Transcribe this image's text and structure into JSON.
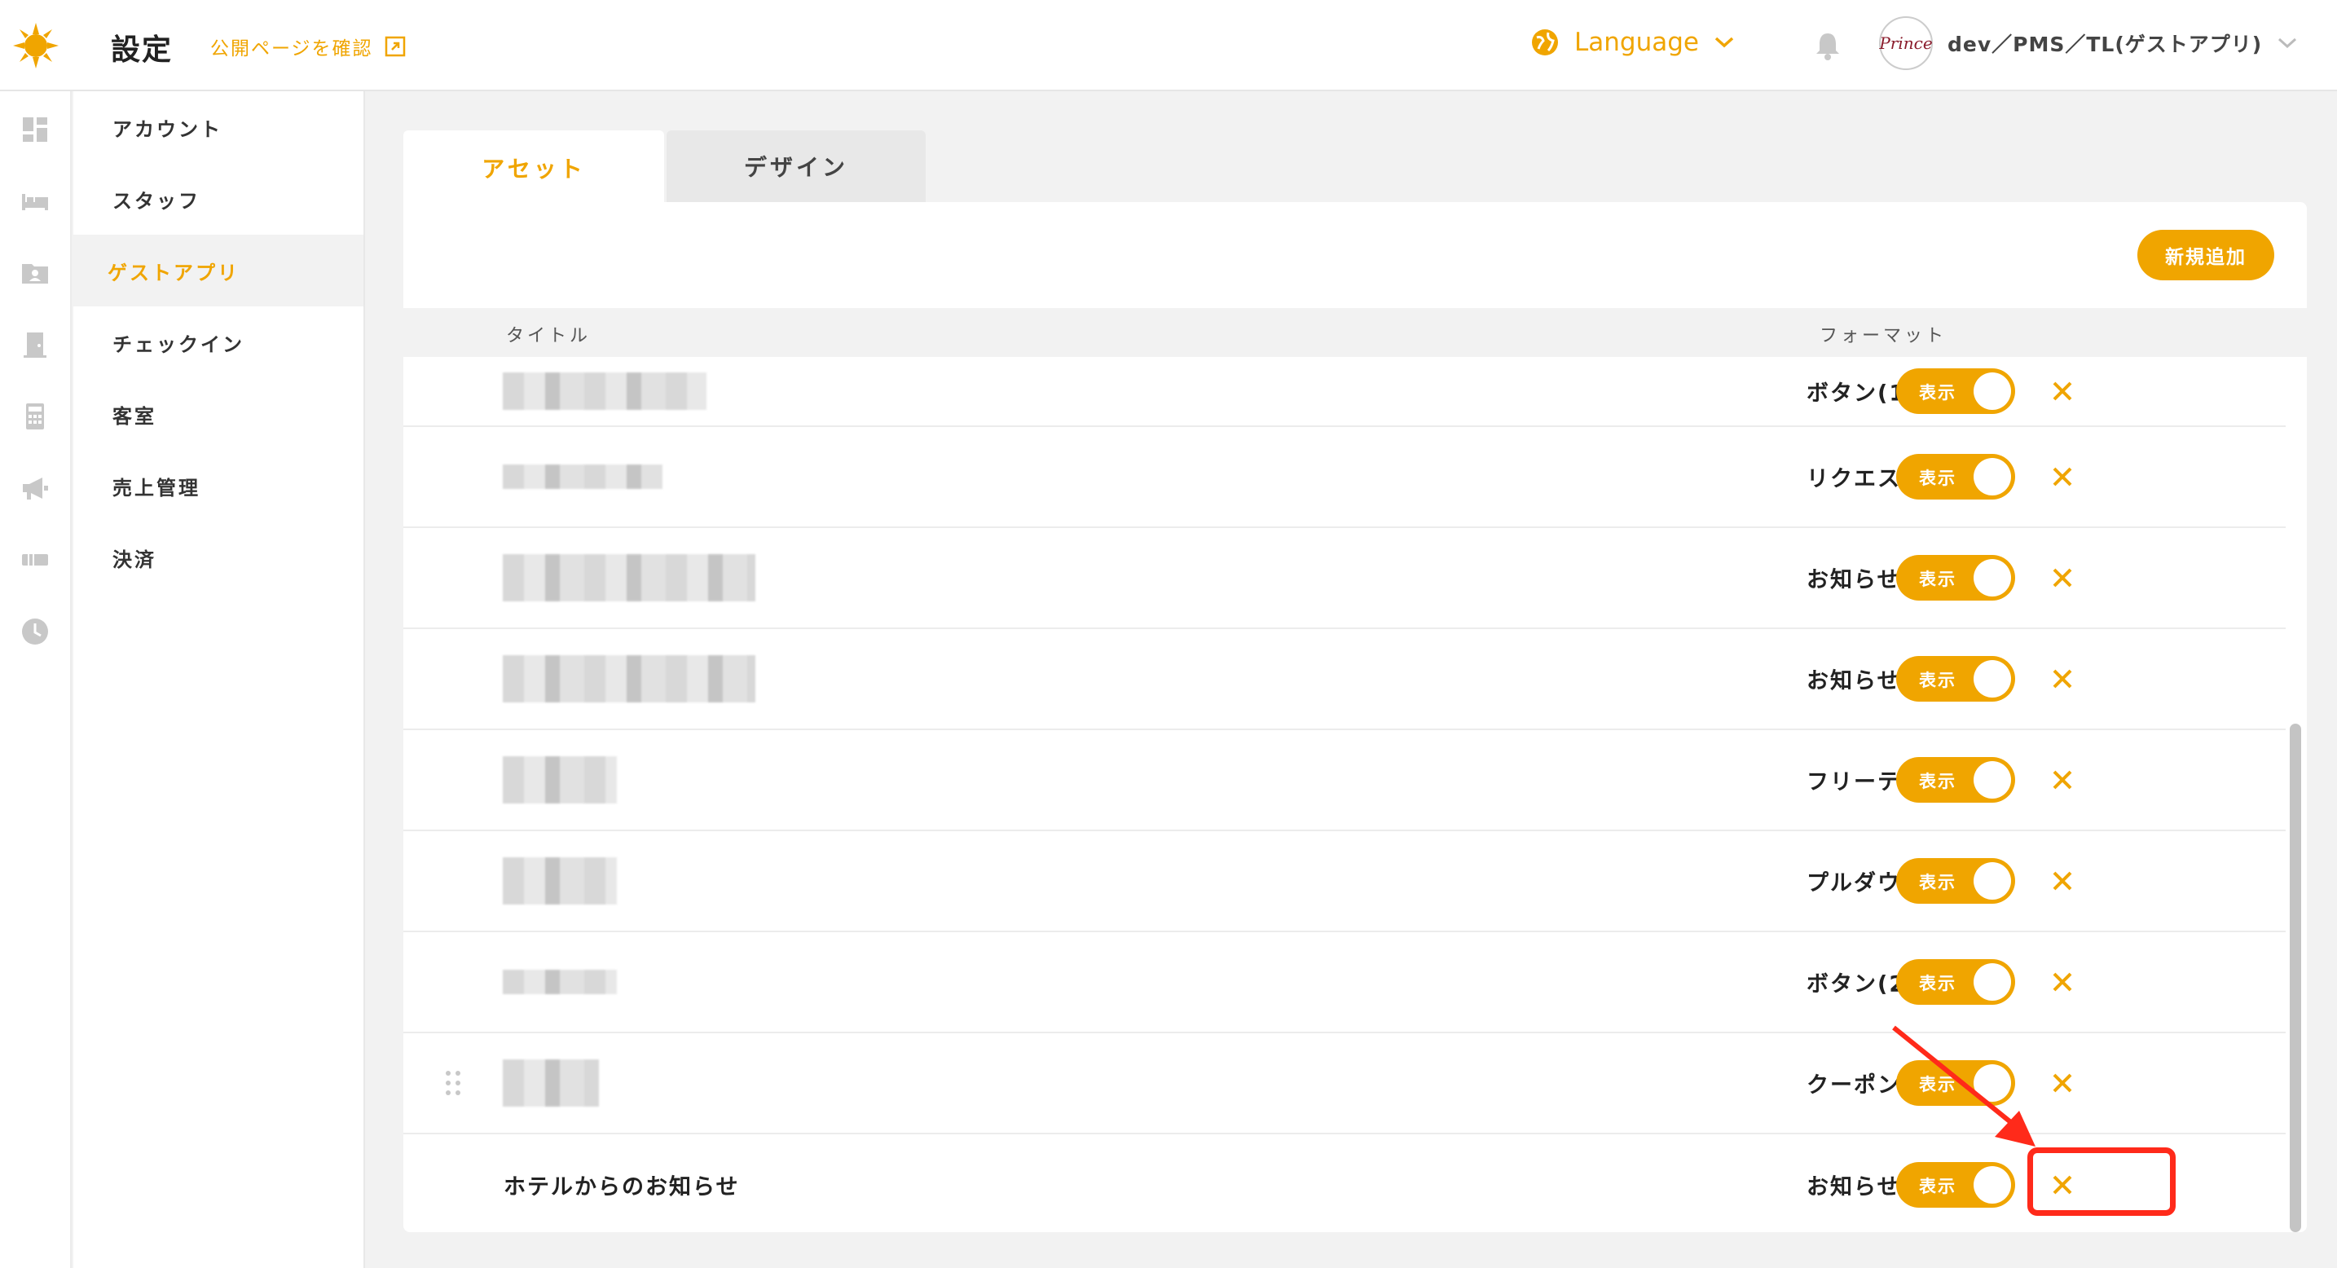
{
  "header": {
    "page_title": "設定",
    "public_link": "公開ページを確認",
    "language_label": "Language",
    "user_name": "dev／PMS／TL(ゲストアプリ)",
    "avatar_text": "Prince"
  },
  "rail_icons": [
    "dashboard-icon",
    "bed-icon",
    "folder-user-icon",
    "door-icon",
    "calculator-icon",
    "megaphone-icon",
    "ticket-icon",
    "clock-icon"
  ],
  "sidebar": {
    "items": [
      {
        "label": "アカウント",
        "active": false
      },
      {
        "label": "スタッフ",
        "active": false
      },
      {
        "label": "ゲストアプリ",
        "active": true
      },
      {
        "label": "チェックイン",
        "active": false
      },
      {
        "label": "客室",
        "active": false
      },
      {
        "label": "売上管理",
        "active": false
      },
      {
        "label": "決済",
        "active": false
      }
    ]
  },
  "tabs": [
    {
      "label": "アセット",
      "active": true
    },
    {
      "label": "デザイン",
      "active": false
    }
  ],
  "toolbar": {
    "add_label": "新規追加"
  },
  "table": {
    "columns": [
      "タイトル",
      "フォーマット"
    ],
    "rows": [
      {
        "title": "",
        "format": "ボタン(1)",
        "toggle": "表示"
      },
      {
        "title": "",
        "format": "リクエスト",
        "toggle": "表示"
      },
      {
        "title": "",
        "format": "お知らせ",
        "toggle": "表示"
      },
      {
        "title": "",
        "format": "お知らせ",
        "toggle": "表示"
      },
      {
        "title": "",
        "format": "フリーテキスト",
        "toggle": "表示"
      },
      {
        "title": "",
        "format": "プルダウン",
        "toggle": "表示"
      },
      {
        "title": "",
        "format": "ボタン(2)",
        "toggle": "表示"
      },
      {
        "title": "",
        "format": "クーポン",
        "toggle": "表示"
      },
      {
        "title": "ホテルからのお知らせ",
        "format": "お知らせ",
        "toggle": "表示"
      }
    ]
  },
  "colors": {
    "accent": "#f0a500",
    "highlight": "#ff2a1a"
  }
}
